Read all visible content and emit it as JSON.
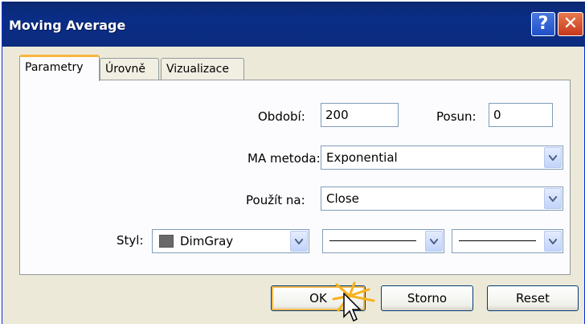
{
  "window": {
    "title": "Moving Average",
    "help_glyph": "?",
    "close_glyph": "✕"
  },
  "tabs": [
    {
      "label": "Parametry",
      "active": true
    },
    {
      "label": "Úrovně",
      "active": false
    },
    {
      "label": "Vizualizace",
      "active": false
    }
  ],
  "params": {
    "period_label": "Období:",
    "period_value": "200",
    "shift_label": "Posun:",
    "shift_value": "0",
    "method_label": "MA metoda:",
    "method_value": "Exponential",
    "apply_label": "Použít na:",
    "apply_value": "Close",
    "style_label": "Styl:",
    "color_value": "DimGray",
    "color_hex": "#696969"
  },
  "buttons": {
    "ok": "OK",
    "cancel": "Storno",
    "reset": "Reset"
  },
  "icons": {
    "dropdown": "chevron-down-icon",
    "cursor": "mouse-pointer-icon",
    "click": "click-burst-icon"
  }
}
